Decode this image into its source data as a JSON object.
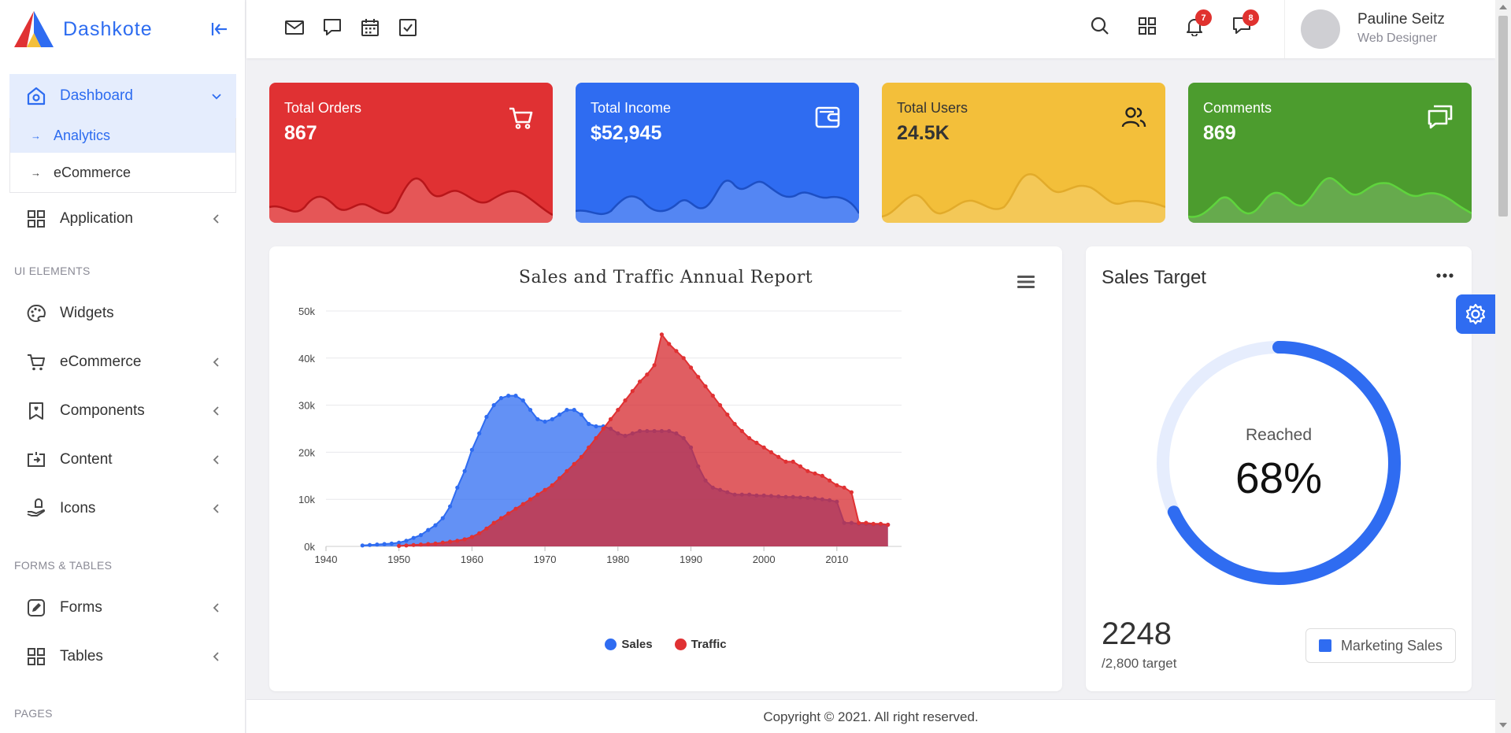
{
  "brand": {
    "name": "Dashkote"
  },
  "sidebar": {
    "dashboard": {
      "label": "Dashboard",
      "sub": [
        {
          "label": "Analytics"
        },
        {
          "label": "eCommerce"
        }
      ]
    },
    "application": "Application",
    "sections": [
      {
        "title": "UI ELEMENTS",
        "items": [
          "Widgets",
          "eCommerce",
          "Components",
          "Content",
          "Icons"
        ]
      },
      {
        "title": "FORMS & TABLES",
        "items": [
          "Forms",
          "Tables"
        ]
      },
      {
        "title": "PAGES"
      }
    ]
  },
  "user": {
    "name": "Pauline Seitz",
    "role": "Web Designer"
  },
  "notifications": {
    "alerts": "7",
    "messages": "8"
  },
  "stats": [
    {
      "label": "Total Orders",
      "value": "867",
      "icon": "cart-icon",
      "color": "#e03133"
    },
    {
      "label": "Total Income",
      "value": "$52,945",
      "icon": "wallet-icon",
      "color": "#2f6cf1"
    },
    {
      "label": "Total Users",
      "value": "24.5K",
      "icon": "users-icon",
      "color": "#f3bf3a"
    },
    {
      "label": "Comments",
      "value": "869",
      "icon": "chat-icon",
      "color": "#4c9c2e"
    }
  ],
  "chart_data": {
    "type": "area",
    "title": "Sales and Traffic Annual Report",
    "xlim": [
      1940,
      2018
    ],
    "ylim": [
      0,
      50000
    ],
    "xticks": [
      "1940",
      "1950",
      "1960",
      "1970",
      "1980",
      "1990",
      "2000",
      "2010"
    ],
    "yticks": [
      "0k",
      "10k",
      "20k",
      "30k",
      "40k",
      "50k"
    ],
    "legend": "bottom-center",
    "grid": true,
    "series": [
      {
        "name": "Sales",
        "color": "#2f6cf1",
        "x": [
          1945,
          1946,
          1947,
          1948,
          1949,
          1950,
          1951,
          1952,
          1953,
          1954,
          1955,
          1956,
          1957,
          1958,
          1959,
          1960,
          1961,
          1962,
          1963,
          1964,
          1965,
          1966,
          1967,
          1968,
          1969,
          1970,
          1971,
          1972,
          1973,
          1974,
          1975,
          1976,
          1977,
          1978,
          1979,
          1980,
          1981,
          1982,
          1983,
          1984,
          1985,
          1986,
          1987,
          1988,
          1989,
          1990,
          1991,
          1992,
          1993,
          1994,
          1995,
          1996,
          1997,
          1998,
          1999,
          2000,
          2001,
          2002,
          2003,
          2004,
          2005,
          2006,
          2007,
          2008,
          2009,
          2010,
          2011,
          2012,
          2013,
          2014,
          2015,
          2016,
          2017
        ],
        "values": [
          200,
          300,
          400,
          500,
          600,
          800,
          1200,
          1800,
          2400,
          3500,
          4500,
          6000,
          8500,
          12500,
          16000,
          20500,
          24000,
          27500,
          30000,
          31500,
          32000,
          32000,
          31000,
          29000,
          27000,
          26500,
          27000,
          28000,
          29000,
          29000,
          28000,
          26000,
          25500,
          25500,
          25000,
          24000,
          23500,
          24000,
          24500,
          24500,
          24500,
          24500,
          24500,
          24000,
          23000,
          21000,
          17000,
          14000,
          12500,
          12000,
          11500,
          11000,
          11000,
          11000,
          10800,
          10800,
          10700,
          10600,
          10500,
          10500,
          10400,
          10300,
          10200,
          10000,
          9800,
          9500,
          5000,
          5000,
          4800,
          4800,
          4700,
          4700,
          4600
        ]
      },
      {
        "name": "Traffic",
        "color": "#e03133",
        "x": [
          1950,
          1951,
          1952,
          1953,
          1954,
          1955,
          1956,
          1957,
          1958,
          1959,
          1960,
          1961,
          1962,
          1963,
          1964,
          1965,
          1966,
          1967,
          1968,
          1969,
          1970,
          1971,
          1972,
          1973,
          1974,
          1975,
          1976,
          1977,
          1978,
          1979,
          1980,
          1981,
          1982,
          1983,
          1984,
          1985,
          1986,
          1987,
          1988,
          1989,
          1990,
          1991,
          1992,
          1993,
          1994,
          1995,
          1996,
          1997,
          1998,
          1999,
          2000,
          2001,
          2002,
          2003,
          2004,
          2005,
          2006,
          2007,
          2008,
          2009,
          2010,
          2011,
          2012,
          2013,
          2014,
          2015,
          2016,
          2017
        ],
        "values": [
          100,
          200,
          300,
          400,
          500,
          600,
          800,
          1000,
          1200,
          1500,
          2000,
          2800,
          3800,
          5000,
          6000,
          7000,
          8000,
          9000,
          10000,
          11000,
          12000,
          13000,
          14500,
          16000,
          17500,
          19000,
          21000,
          23000,
          25000,
          27000,
          29000,
          31000,
          33000,
          35000,
          36500,
          38500,
          45000,
          43000,
          41500,
          40000,
          38000,
          36000,
          34000,
          32000,
          30000,
          28000,
          26000,
          24500,
          23000,
          22000,
          21000,
          20000,
          19000,
          18000,
          18000,
          17000,
          16000,
          15500,
          15000,
          14000,
          13000,
          12500,
          11500,
          5000,
          5000,
          4800,
          4800,
          4600
        ]
      }
    ]
  },
  "target": {
    "title": "Sales Target",
    "reached_label": "Reached",
    "percent": 68,
    "percent_text": "68%",
    "value": "2248",
    "target_text": "/2,800 target",
    "button": "Marketing Sales"
  },
  "footer": {
    "text": "Copyright © 2021. All right reserved."
  }
}
